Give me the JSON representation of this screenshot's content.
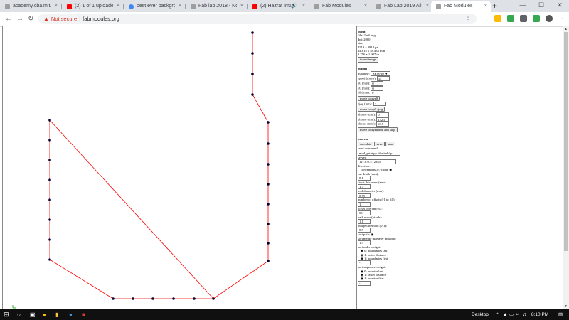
{
  "browser": {
    "tabs": [
      {
        "title": "academy.cba.mit.e",
        "favicon_color": "#9e9e9e"
      },
      {
        "title": "(2) 1 of 1 uploaded",
        "favicon_color": "#ff0000"
      },
      {
        "title": "best ever backgrou",
        "favicon_color": "#4285f4"
      },
      {
        "title": "Fab lab 2018 - Noo",
        "favicon_color": "#9e9e9e"
      },
      {
        "title": "(2) Hazrat Imar",
        "favicon_color": "#ff0000"
      },
      {
        "title": "Fab Modules",
        "favicon_color": "#9e9e9e"
      },
      {
        "title": "Fab Lab 2019 All Ra",
        "favicon_color": "#9e9e9e"
      },
      {
        "title": "Fab Modules",
        "favicon_color": "#9e9e9e"
      }
    ],
    "close_glyph": "×",
    "new_tab": "+",
    "url_security": "Not secure",
    "url": "fabmodules.org",
    "url_sep": "|"
  },
  "panel": {
    "input": {
      "heading": "input",
      "file": "file: 2in8.png",
      "dpi": "dpi: 2000",
      "size_label": "size:",
      "size_px": "2513 x 3814 px",
      "size_mm": "44.615 x 48.435 mm",
      "size_in": "1.756 x 1.907 in",
      "invert_button": "invert image"
    },
    "output": {
      "heading": "output",
      "machine_label": "machine:",
      "machine_value": "SRM-20 ▼",
      "speed_label": "speed (mm/s):",
      "speed_value": "4",
      "x0_label": "x0 (mm):",
      "x0_value": "0",
      "y0_label": "y0 (mm):",
      "y0_value": "0",
      "z0_label": "z0 (mm):",
      "z0_value": "0",
      "move_xyz0": "move to xyz0",
      "zjog_label": "zjog (mm):",
      "zjog_value": "2",
      "move_xyjog": "move to xy0 zjog",
      "xhome_label": "xhome (mm):",
      "xhome_value": "0",
      "yhome_label": "yhome (mm):",
      "yhome_value": "152.4",
      "zhome_label": "zhome (mm):",
      "zhome_value": "60.5",
      "move_home": "move to xyzhome and stop"
    },
    "process": {
      "heading": "process",
      "calculate": "calculate",
      "save": "save",
      "send": "send",
      "send_command_label": "send command:",
      "send_command_value": "mod_print.py /dev/usb/lp",
      "server_label": "server:",
      "server_value": "127.0.0.1:12345",
      "direction_label": "direction:",
      "direction_value": "conventional ○ climb ◉",
      "cut_depth_label": "cut depth (mm):",
      "cut_depth_value": "0.1",
      "stock_label": "stock thickness (mm):",
      "stock_value": "1.7",
      "tool_label": "tool diameter (mm):",
      "tool_value": "0.79",
      "offsets_label": "number of offsets (-1 to fill):",
      "offsets_value": "1",
      "overlap_label": "offset overlap (%):",
      "overlap_value": "50",
      "path_error_label": "path error (pixels):",
      "path_error_value": "1.1",
      "threshold_label": "image threshold (0-1):",
      "threshold_value": "0.5",
      "sort_label": "sort path: ◉",
      "merge_label": "sort merge diameter multiple:",
      "merge_value": "1.5",
      "order_label": "sort order weight:",
      "order_opt1": "◉ 0: boundaries last",
      "order_opt2": "◉ 1: raster distance",
      "order_opt3": "◉ 1: boundaries first",
      "order_value": "-1",
      "sequence_label": "sort sequence weight:",
      "seq_opt1": "◉ 0: exterior last",
      "seq_opt2": "◉ 1: raster distance",
      "seq_opt3": "◉ 1: exterior first",
      "sequence_value": "-1"
    }
  },
  "canvas": {
    "path_color": "#ff0000",
    "point_color": "#000033"
  },
  "taskbar": {
    "desktop_label": "Desktop",
    "time": "8:10 PM",
    "chevron": "^"
  }
}
